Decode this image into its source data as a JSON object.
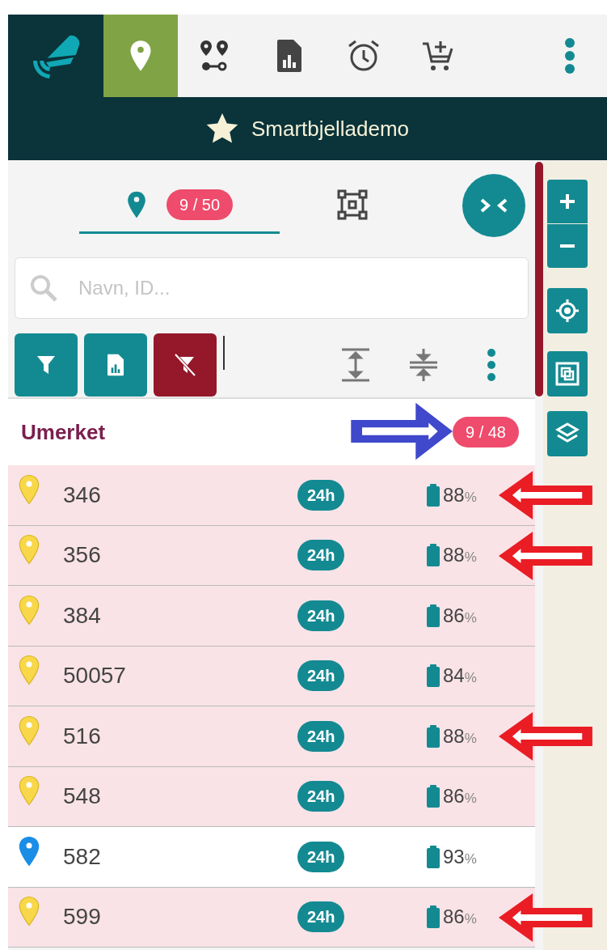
{
  "nav": [
    {
      "kind": "location",
      "selected": true
    },
    {
      "kind": "route",
      "selected": false
    },
    {
      "kind": "report",
      "selected": false
    },
    {
      "kind": "alarm",
      "selected": false
    },
    {
      "kind": "cart",
      "selected": false
    },
    {
      "kind": "more",
      "selected": false
    }
  ],
  "title": "Smartbjellademo",
  "tabs": [
    {
      "kind": "pins",
      "selected": true,
      "badge": "9 / 50"
    },
    {
      "kind": "polygon",
      "selected": false
    }
  ],
  "search": {
    "placeholder": "Navn, ID..."
  },
  "tools": [
    {
      "kind": "filter"
    },
    {
      "kind": "report"
    },
    {
      "kind": "clear-filter"
    }
  ],
  "view_tools": [
    {
      "kind": "expand"
    },
    {
      "kind": "collapse"
    },
    {
      "kind": "more"
    }
  ],
  "group": {
    "title": "Umerket",
    "count": "9 / 48",
    "arrow": true
  },
  "rows": [
    {
      "id": "346",
      "color": "#f8d84a",
      "selected": true,
      "period": "24h",
      "battery": "88",
      "unit": "%",
      "arrow": true
    },
    {
      "id": "356",
      "color": "#f8d84a",
      "selected": true,
      "period": "24h",
      "battery": "88",
      "unit": "%",
      "arrow": true
    },
    {
      "id": "384",
      "color": "#f8d84a",
      "selected": true,
      "period": "24h",
      "battery": "86",
      "unit": "%",
      "arrow": false
    },
    {
      "id": "50057",
      "color": "#f8d84a",
      "selected": true,
      "period": "24h",
      "battery": "84",
      "unit": "%",
      "arrow": false
    },
    {
      "id": "516",
      "color": "#f8d84a",
      "selected": true,
      "period": "24h",
      "battery": "88",
      "unit": "%",
      "arrow": true
    },
    {
      "id": "548",
      "color": "#f8d84a",
      "selected": true,
      "period": "24h",
      "battery": "86",
      "unit": "%",
      "arrow": false
    },
    {
      "id": "582",
      "color": "#1a8ee6",
      "selected": false,
      "period": "24h",
      "battery": "93",
      "unit": "%",
      "arrow": false
    },
    {
      "id": "599",
      "color": "#f8d84a",
      "selected": true,
      "period": "24h",
      "battery": "86",
      "unit": "%",
      "arrow": true
    }
  ],
  "map_controls": [
    {
      "kind": "zoom-in"
    },
    {
      "kind": "zoom-out"
    },
    {
      "kind": "locate"
    },
    {
      "kind": "fit"
    },
    {
      "kind": "layers"
    }
  ]
}
